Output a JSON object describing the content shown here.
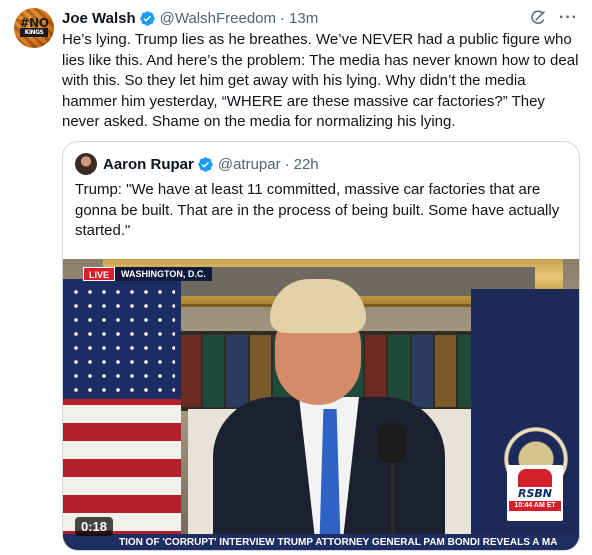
{
  "tweet": {
    "author": {
      "display_name": "Joe Walsh",
      "handle": "@WalshFreedom",
      "avatar_text_top": "#NO",
      "avatar_text_bottom": "KINGS"
    },
    "separator": "·",
    "time": "13m",
    "text": "He’s lying. Trump lies as he breathes. We’ve NEVER had a public figure who lies like this. And here’s the problem: The media has never known how to deal with this. So they let him get away with his lying. Why didn’t the media hammer him yesterday, “WHERE are these massive car factories?” They never asked. Shame on the media for normalizing his lying.",
    "icons": [
      "grok-icon",
      "more-icon"
    ],
    "more_label": "···"
  },
  "quoted_tweet": {
    "author": {
      "display_name": "Aaron Rupar",
      "handle": "@atrupar"
    },
    "separator": "·",
    "time": "22h",
    "text": "Trump: \"We have at least 11 committed, massive car factories that are gonna be built. That are in the process of being built. Some have actually started.\"",
    "video": {
      "live_label": "LIVE",
      "location": "WASHINGTON, D.C.",
      "logo_name": "RSBN",
      "logo_time": "10:44 AM ET",
      "ticker": "TION OF 'CORRUPT' INTERVIEW   TRUMP ATTORNEY GENERAL PAM BONDI REVEALS A MA",
      "duration": "0:18"
    }
  },
  "colors": {
    "verified_blue": "#1d9bf0",
    "text_primary": "#0f1419",
    "text_secondary": "#536471",
    "border": "#cfd9de",
    "live_red": "#d51f2a"
  }
}
